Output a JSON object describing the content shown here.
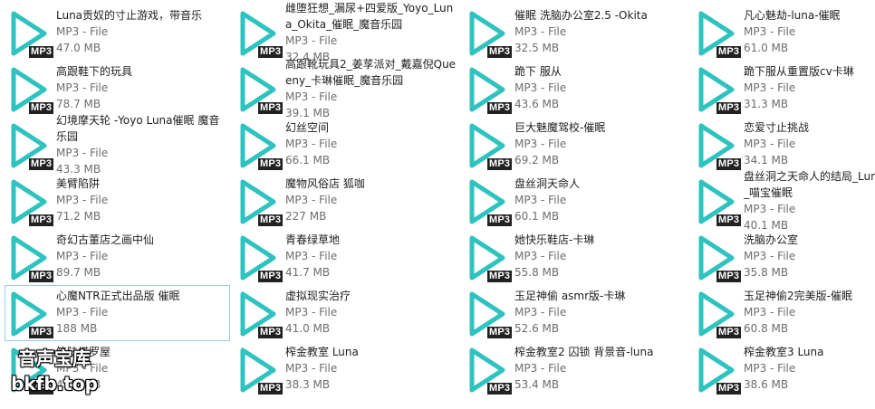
{
  "type_label": "MP3 - File",
  "badge_label": "MP3",
  "icon": "play-icon",
  "accent_color": "#2ec3bf",
  "selected_index": 20,
  "files": [
    {
      "name": "Luna贡奴的寸止游戏，带音乐",
      "size": "47.0 MB"
    },
    {
      "name": "雌堕狂想_漏尿+四爱版_Yoyo_Luna_Okita_催眠_魔音乐园",
      "size": "32.4 MB"
    },
    {
      "name": "催眠 洗脑办公室2.5 -Okita",
      "size": "32.5 MB"
    },
    {
      "name": "凡心魅劫-luna-催眠",
      "size": "61.0 MB"
    },
    {
      "name": "高跟鞋下的玩具",
      "size": "78.7 MB"
    },
    {
      "name": "高跟靴玩具2_姜莩派对_戴嘉倪Queeny_卡琳催眠_魔音乐园",
      "size": "39.1 MB"
    },
    {
      "name": "跪下 服从",
      "size": "43.6 MB"
    },
    {
      "name": "跪下服从重置版cv卡琳",
      "size": "31.3 MB"
    },
    {
      "name": "幻境摩天轮 -Yoyo Luna催眠 魔音乐园",
      "size": "43.3 MB"
    },
    {
      "name": "幻丝空间",
      "size": "66.1 MB"
    },
    {
      "name": "巨大魅魔驾校-催眠",
      "size": "69.2 MB"
    },
    {
      "name": "恋爱寸止挑战",
      "size": "34.1 MB"
    },
    {
      "name": "美臂陷阱",
      "size": "71.2 MB"
    },
    {
      "name": "魔物风俗店 狐咖",
      "size": "227 MB"
    },
    {
      "name": "盘丝洞天命人",
      "size": "60.1 MB"
    },
    {
      "name": "盘丝洞之天命人的结局_Luna_yoyo_喵宝催眠",
      "size": "40.1 MB"
    },
    {
      "name": "奇幻古董店之画中仙",
      "size": "89.7 MB"
    },
    {
      "name": "青春绿草地",
      "size": "41.7 MB"
    },
    {
      "name": "她快乐鞋店-卡琳",
      "size": "55.8 MB"
    },
    {
      "name": "洗脑办公室",
      "size": "35.8 MB"
    },
    {
      "name": "心魔NTR正式出品版 催眠",
      "size": "188 MB"
    },
    {
      "name": "虚拟现实治疗",
      "size": "41.0 MB"
    },
    {
      "name": "玉足神偷 asmr版-卡琳",
      "size": "52.6 MB"
    },
    {
      "name": "玉足神偷2完美版-催眠",
      "size": "60.8 MB"
    },
    {
      "name": "竺陆塔罗屋",
      "size": "43.0 MB"
    },
    {
      "name": "榨金教室 Luna",
      "size": "38.3 MB"
    },
    {
      "name": "榨金教室2 囚锁 背景音-luna",
      "size": "53.4 MB"
    },
    {
      "name": "榨金教室3 Luna",
      "size": "38.6 MB"
    }
  ],
  "watermark": {
    "line1": "音声宝库",
    "line2": "bkfb.top"
  }
}
